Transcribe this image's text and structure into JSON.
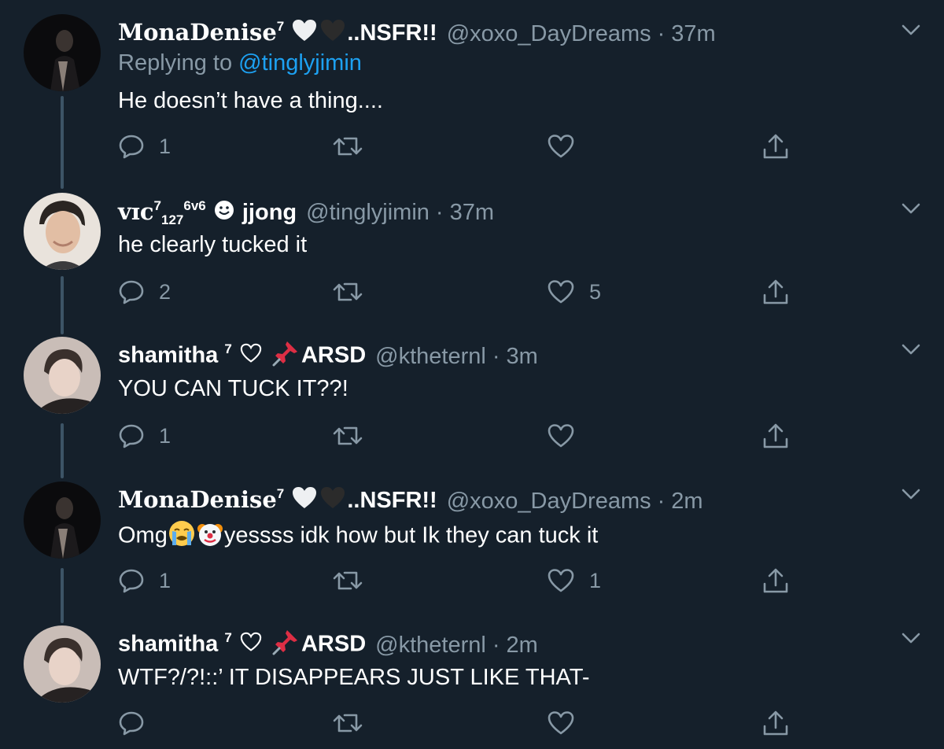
{
  "tweets": [
    {
      "name_main": "MonaDenise",
      "name_sup": "7",
      "name_tail": "..NSFR!!",
      "handle": "@xoxo_DayDreams",
      "separator": "·",
      "time": "37m",
      "replying_prefix": "Replying to",
      "replying_to": "@tinglyjimin",
      "text": "He doesn’t have a thing....",
      "reply_count": "1",
      "retweet_count": "",
      "like_count": ""
    },
    {
      "name_main": "vɪc",
      "name_sup": "7",
      "name_sub": "127",
      "name_sup2": "6v6",
      "name_tail": "jjong",
      "handle": "@tinglyjimin",
      "separator": "·",
      "time": "37m",
      "text": "he clearly tucked it",
      "reply_count": "2",
      "retweet_count": "",
      "like_count": "5"
    },
    {
      "name_main": "shamitha",
      "name_sup": "7",
      "name_tail": "ARSD",
      "handle": "@ktheternl",
      "separator": "·",
      "time": "3m",
      "text": "YOU CAN TUCK IT??!",
      "reply_count": "1",
      "retweet_count": "",
      "like_count": ""
    },
    {
      "name_main": "MonaDenise",
      "name_sup": "7",
      "name_tail": "..NSFR!!",
      "handle": "@xoxo_DayDreams",
      "separator": "·",
      "time": "2m",
      "text_prefix": "Omg",
      "text_suffix": "yessss idk how but Ik they can tuck it",
      "reply_count": "1",
      "retweet_count": "",
      "like_count": "1"
    },
    {
      "name_main": "shamitha",
      "name_sup": "7",
      "name_tail": "ARSD",
      "handle": "@ktheternl",
      "separator": "·",
      "time": "2m",
      "text": "WTF?/?!::’ IT DISAPPEARS JUST LIKE THAT-",
      "reply_count": "",
      "retweet_count": "",
      "like_count": ""
    }
  ],
  "colors": {
    "background": "#15202b",
    "secondary_text": "#8899a6",
    "link": "#1da1f2",
    "thread_line": "#3d5466"
  },
  "icons": [
    "reply-icon",
    "retweet-icon",
    "like-icon",
    "share-icon",
    "chevron-down-icon",
    "white-heart-icon",
    "black-heart-icon",
    "pushpin-icon",
    "smiley-icon",
    "crying-face-icon",
    "clown-face-icon"
  ]
}
